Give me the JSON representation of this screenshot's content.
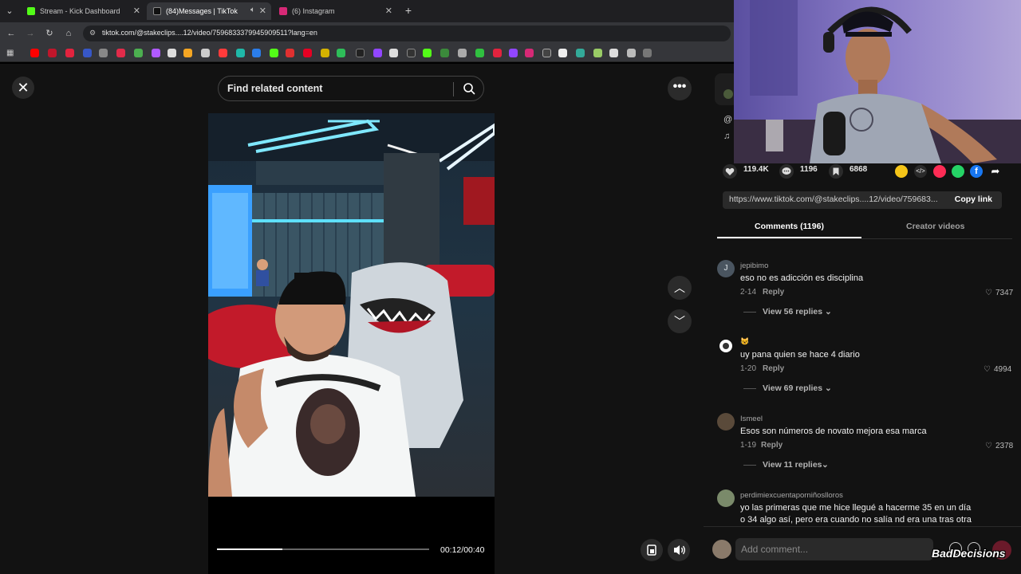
{
  "browser": {
    "tabs": [
      {
        "title": "Stream - Kick Dashboard",
        "favicon_color": "#53fc18"
      },
      {
        "title": "(84)Messages | TikTok",
        "favicon_color": "#111111"
      },
      {
        "title": "(6) Instagram",
        "favicon_color": "#d62976"
      }
    ],
    "new_tab": "+",
    "url": "tiktok.com/@stakeclips....12/video/7596833379945909511?lang=en"
  },
  "tiktok": {
    "search_placeholder": "Find related content",
    "video_time": "00:12/00:40",
    "video_progress": 0.31,
    "stats": {
      "likes": "119.4K",
      "comments": "1196",
      "saves": "6868"
    },
    "partial_letters": {
      "at": "@",
      "note": "♫"
    },
    "share_link": "https://www.tiktok.com/@stakeclips....12/video/759683...",
    "copy_link": "Copy link",
    "tabs": {
      "comments": "Comments (1196)",
      "creator": "Creator videos"
    },
    "comments": [
      {
        "user": "jepibimo",
        "avatar_letter": "J",
        "text": "eso no es adicción es disciplina",
        "date": "2-14",
        "reply": "Reply",
        "likes": "7347",
        "view_replies": "View 56 replies"
      },
      {
        "user": "😺",
        "text": "uy pana quien se hace 4 diario",
        "date": "1-20",
        "reply": "Reply",
        "likes": "4994",
        "view_replies": "View 69 replies"
      },
      {
        "user": "Ismeel",
        "text": "Esos son números de novato mejora esa marca",
        "date": "1-19",
        "reply": "Reply",
        "likes": "2378",
        "view_replies": "View 11 replies"
      },
      {
        "user": "perdimiexcuentaporniñoslloros",
        "text_line1": "yo las primeras que me hice llegué a hacerme 35 en un día",
        "text_line2": "o 34 algo así, pero era cuando no salía nd era una tras otra"
      }
    ],
    "add_comment_placeholder": "Add comment...",
    "watermark": "BadDecisions"
  }
}
